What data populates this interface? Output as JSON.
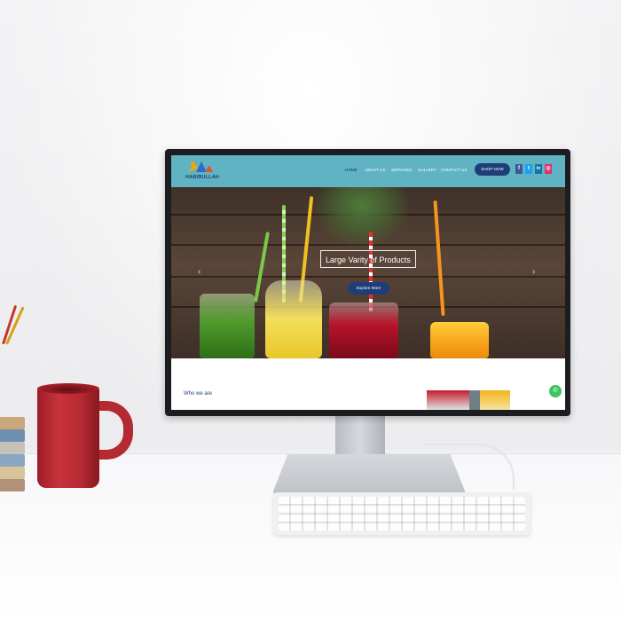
{
  "website": {
    "brand": "HABIBULLAH",
    "nav": [
      {
        "label": "HOME",
        "active": true
      },
      {
        "label": "ABOUT US",
        "active": false
      },
      {
        "label": "SERVICES",
        "active": false
      },
      {
        "label": "GALLERY",
        "active": false
      },
      {
        "label": "CONTACT US",
        "active": false
      }
    ],
    "shop_button": "SHOP NOW",
    "social": [
      {
        "icon": "facebook-icon",
        "glyph": "f",
        "color": "#3b5998"
      },
      {
        "icon": "twitter-icon",
        "glyph": "t",
        "color": "#1da1f2"
      },
      {
        "icon": "linkedin-icon",
        "glyph": "in",
        "color": "#0e76a8"
      },
      {
        "icon": "instagram-icon",
        "glyph": "◎",
        "color": "#e1306c"
      }
    ],
    "hero": {
      "title": "Large Varity of Products",
      "button": "Explore More",
      "prev_arrow": "‹",
      "next_arrow": "›",
      "slide_count": 3,
      "active_slide": 1
    },
    "about": {
      "title": "Who we are"
    },
    "whatsapp_icon": "whatsapp-icon",
    "colors": {
      "header": "#5fb3c2",
      "accent": "#1f3e78",
      "whatsapp": "#3ac55f"
    }
  }
}
